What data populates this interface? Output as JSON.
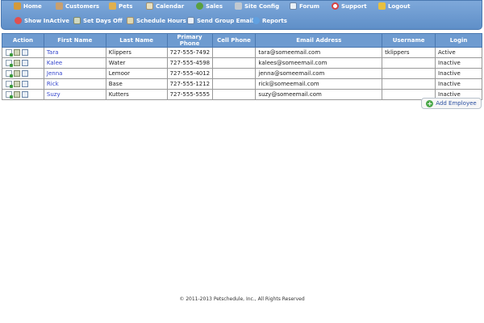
{
  "nav": {
    "row1": [
      {
        "label": "Home",
        "icon": "home-icon",
        "color": "#d49a3a"
      },
      {
        "label": "Customers",
        "icon": "customers-icon",
        "color": "#c8a070"
      },
      {
        "label": "Pets",
        "icon": "pets-icon",
        "color": "#e0b050"
      },
      {
        "label": "Calendar",
        "icon": "calendar-icon",
        "color": "#e8e0c0"
      },
      {
        "label": "Sales",
        "icon": "sales-icon",
        "color": "#5aa040"
      },
      {
        "label": "Site Config",
        "icon": "wrench-icon",
        "color": "#c0c8d0"
      },
      {
        "label": "Forum",
        "icon": "forum-icon",
        "color": "#e8f0f8"
      },
      {
        "label": "Support",
        "icon": "support-icon",
        "color": "#d84040"
      },
      {
        "label": "Logout",
        "icon": "key-icon",
        "color": "#e8c040"
      }
    ],
    "row2": [
      {
        "label": "Show InActive",
        "icon": "inactive-icon",
        "color": "#e05050"
      },
      {
        "label": "Set Days Off",
        "icon": "days-off-icon",
        "color": "#d0d8c0"
      },
      {
        "label": "Schedule Hours",
        "icon": "schedule-icon",
        "color": "#e0d8b0"
      },
      {
        "label": "Send Group Email",
        "icon": "email-icon",
        "color": "#e8eef6"
      },
      {
        "label": "Reports",
        "icon": "reports-icon",
        "color": "#60a0e0"
      }
    ]
  },
  "table": {
    "headers": [
      "Action",
      "First Name",
      "Last Name",
      "Primary Phone",
      "Cell Phone",
      "Email Address",
      "Username",
      "Login"
    ],
    "rows": [
      {
        "first": "Tara",
        "last": "Klippers",
        "phone": "727-555-7492",
        "cell": "",
        "email": "tara@someemail.com",
        "username": "tklippers",
        "login": "Active"
      },
      {
        "first": "Kalee",
        "last": "Water",
        "phone": "727-555-4598",
        "cell": "",
        "email": "kalees@someemail.com",
        "username": "",
        "login": "Inactive"
      },
      {
        "first": "Jenna",
        "last": "Lemoor",
        "phone": "727-555-4012",
        "cell": "",
        "email": "jenna@someemail.com",
        "username": "",
        "login": "Inactive"
      },
      {
        "first": "Rick",
        "last": "Base",
        "phone": "727-555-1212",
        "cell": "",
        "email": "rick@someemail.com",
        "username": "",
        "login": "Inactive"
      },
      {
        "first": "Suzy",
        "last": "Kutters",
        "phone": "727-555-5555",
        "cell": "",
        "email": "suzy@someemail.com",
        "username": "",
        "login": "Inactive"
      }
    ]
  },
  "add_employee_label": "Add Employee",
  "footer": "© 2011-2013 Petschedule, Inc., All Rights Reserved"
}
